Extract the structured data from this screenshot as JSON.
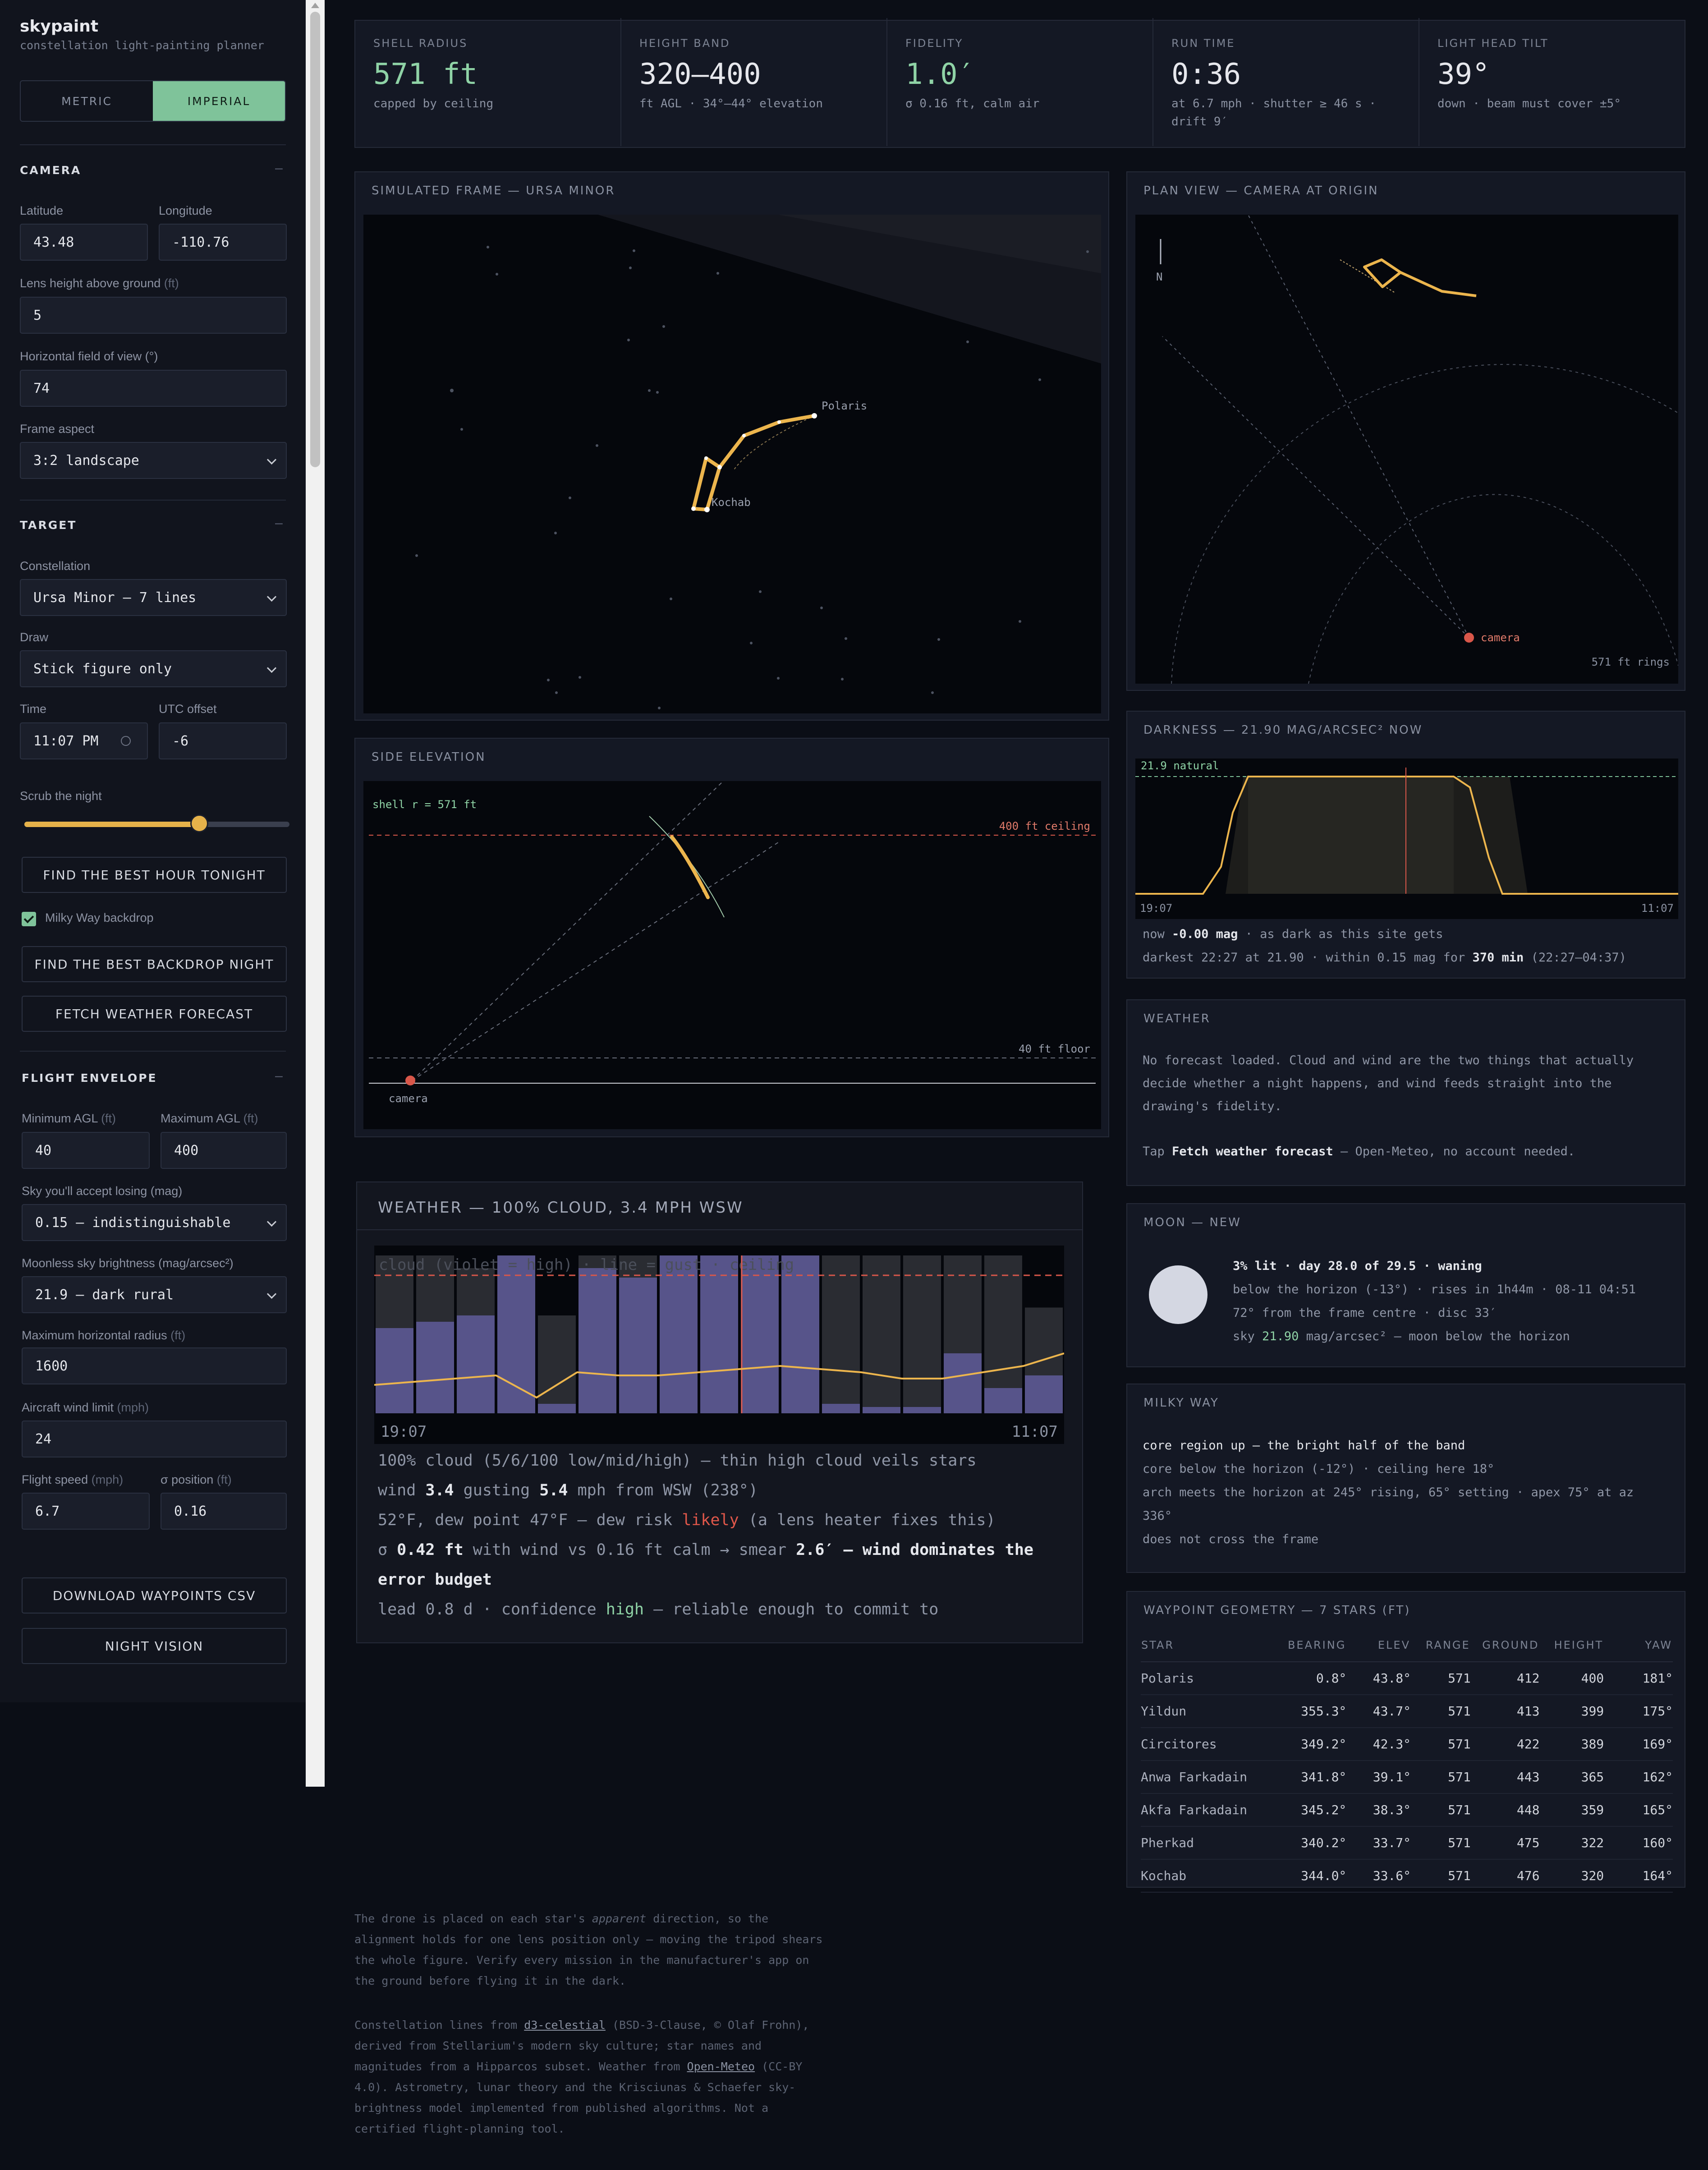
{
  "app": {
    "title": "skypaint",
    "subtitle": "constellation light-painting planner"
  },
  "units": {
    "metric": "METRIC",
    "imperial": "IMPERIAL",
    "selected": "IMPERIAL"
  },
  "camera": {
    "heading": "CAMERA",
    "collapse": "–",
    "latitude_label": "Latitude",
    "latitude": "43.48",
    "longitude_label": "Longitude",
    "longitude": "-110.76",
    "lens_label": "Lens height above ground",
    "lens_unit": "(ft)",
    "lens": "5",
    "fov_label": "Horizontal field of view (°)",
    "fov": "74",
    "aspect_label": "Frame aspect",
    "aspect": "3:2 landscape"
  },
  "target": {
    "heading": "TARGET",
    "collapse": "–",
    "constellation_label": "Constellation",
    "constellation": "Ursa Minor — 7 lines",
    "draw_label": "Draw",
    "draw": "Stick figure only",
    "time_label": "Time",
    "time": "11:07 PM",
    "utc_label": "UTC offset",
    "utc": "-6",
    "scrub_label": "Scrub the night",
    "scrub_fraction": 0.66,
    "best_hour_button": "FIND THE BEST HOUR TONIGHT",
    "milky_way_label": "Milky Way backdrop",
    "milky_way_checked": true,
    "best_backdrop_button": "FIND THE BEST BACKDROP NIGHT",
    "fetch_weather_button": "FETCH WEATHER FORECAST"
  },
  "flight": {
    "heading": "FLIGHT ENVELOPE",
    "collapse": "–",
    "min_agl_label": "Minimum AGL",
    "min_agl_unit": "(ft)",
    "min_agl": "40",
    "max_agl_label": "Maximum AGL",
    "max_agl_unit": "(ft)",
    "max_agl": "400",
    "sky_lose_label": "Sky you'll accept losing (mag)",
    "sky_lose": "0.15 — indistinguishable",
    "moonless_label": "Moonless sky brightness (mag/arcsec²)",
    "moonless": "21.9 — dark rural",
    "max_radius_label": "Maximum horizontal radius",
    "max_radius_unit": "(ft)",
    "max_radius": "1600",
    "wind_limit_label": "Aircraft wind limit",
    "wind_limit_unit": "(mph)",
    "wind_limit": "24",
    "speed_label": "Flight speed",
    "speed_unit": "(mph)",
    "speed": "6.7",
    "sigma_label": "σ position",
    "sigma_unit": "(ft)",
    "sigma": "0.16",
    "download_button": "DOWNLOAD WAYPOINTS CSV",
    "night_vision_button": "NIGHT VISION"
  },
  "kpis": [
    {
      "label": "SHELL RADIUS",
      "value": "571 ft",
      "note": "capped by ceiling",
      "accent": true
    },
    {
      "label": "HEIGHT BAND",
      "value": "320–400",
      "note": "ft AGL · 34°–44° elevation",
      "accent": false
    },
    {
      "label": "FIDELITY",
      "value": "1.0′",
      "note": "σ 0.16 ft, calm air",
      "accent": true
    },
    {
      "label": "RUN TIME",
      "value": "0:36",
      "note": "at 6.7 mph · shutter ≥ 46 s · drift 9′",
      "accent": false
    },
    {
      "label": "LIGHT HEAD TILT",
      "value": "39°",
      "note": "down · beam must cover ±5°",
      "accent": false
    }
  ],
  "sim_frame": {
    "title": "SIMULATED FRAME — URSA MINOR",
    "star_polaris": "Polaris",
    "star_kochab": "Kochab"
  },
  "plan_view": {
    "title": "PLAN VIEW — CAMERA AT ORIGIN",
    "north": "N",
    "camera": "camera",
    "rings": "571 ft rings"
  },
  "side_elev": {
    "title": "SIDE ELEVATION",
    "shell": "shell r = 571 ft",
    "ceiling": "400 ft ceiling",
    "floor": "40 ft floor",
    "camera": "camera"
  },
  "darkness": {
    "title": "DARKNESS — 21.90 MAG/ARCSEC² NOW",
    "natural_label": "21.9 natural",
    "start_time": "19:07",
    "end_time": "11:07",
    "now_prefix": "now",
    "now_value": "-0.00 mag",
    "now_suffix": "· as dark as this site gets",
    "darkest_text": "darkest 22:27 at 21.90 · within 0.15 mag for",
    "darkest_value": "370 min",
    "darkest_range": "(22:27–04:37)"
  },
  "weather_panel": {
    "title": "WEATHER",
    "p1": "No forecast loaded. Cloud and wind are the two things that actually decide whether a night happens, and wind feeds straight into the drawing's fidelity.",
    "p2_prefix": "Tap",
    "p2_bold": "Fetch weather forecast",
    "p2_suffix": "— Open-Meteo, no account needed."
  },
  "moon": {
    "title": "MOON — NEW",
    "line1": "3% lit · day 28.0 of 29.5 · waning",
    "line2": "below the horizon (-13°) · rises in 1h44m · 08-11 04:51",
    "line3": "72° from the frame centre · disc 33′",
    "line4_prefix": "sky",
    "line4_value": "21.90",
    "line4_suffix": "mag/arcsec² — moon below the horizon"
  },
  "milky_way": {
    "title": "MILKY WAY",
    "line1": "core region up — the bright half of the band",
    "line2": "core below the horizon (-12°) · ceiling here 18°",
    "line3": "arch meets the horizon at 245° rising, 65° setting · apex 75° at az 336°",
    "line4": "does not cross the frame"
  },
  "waypoints": {
    "title": "WAYPOINT GEOMETRY — 7 STARS (FT)",
    "headers": [
      "STAR",
      "BEARING",
      "ELEV",
      "RANGE",
      "GROUND",
      "HEIGHT",
      "YAW"
    ],
    "rows": [
      [
        "Polaris",
        "0.8°",
        "43.8°",
        "571",
        "412",
        "400",
        "181°"
      ],
      [
        "Yildun",
        "355.3°",
        "43.7°",
        "571",
        "413",
        "399",
        "175°"
      ],
      [
        "Circitores",
        "349.2°",
        "42.3°",
        "571",
        "422",
        "389",
        "169°"
      ],
      [
        "Anwa Farkadain",
        "341.8°",
        "39.1°",
        "571",
        "443",
        "365",
        "162°"
      ],
      [
        "Akfa Farkadain",
        "345.2°",
        "38.3°",
        "571",
        "448",
        "359",
        "165°"
      ],
      [
        "Pherkad",
        "340.2°",
        "33.7°",
        "571",
        "475",
        "322",
        "160°"
      ],
      [
        "Kochab",
        "344.0°",
        "33.6°",
        "571",
        "476",
        "320",
        "164°"
      ]
    ]
  },
  "weather_forecast": {
    "title": "WEATHER — 100% CLOUD, 3.4 MPH WSW",
    "legend": "cloud (violet = high) · line = gust · ceiling",
    "start_time": "19:07",
    "end_time": "11:07",
    "l1": "100% cloud (5/6/100 low/mid/high) — thin high cloud veils stars",
    "l2_a": "wind",
    "l2_b": "3.4",
    "l2_c": "gusting",
    "l2_d": "5.4",
    "l2_e": "mph from WSW (238°)",
    "l3_a": "52°F, dew point 47°F — dew risk",
    "l3_b": "likely",
    "l3_c": "(a lens heater fixes this)",
    "l4_a": "σ",
    "l4_b": "0.42 ft",
    "l4_c": "with wind vs 0.16 ft calm → smear",
    "l4_d": "2.6′ — wind dominates the error budget",
    "l5_a": "lead 0.8 d · confidence",
    "l5_b": "high",
    "l5_c": "— reliable enough to commit to"
  },
  "footer": {
    "p1_a": "The drone is placed on each star's",
    "p1_em": "apparent",
    "p1_b": "direction, so the alignment holds for one lens position only — moving the tripod shears the whole figure. Verify every mission in the manufacturer's app on the ground before flying it in the dark.",
    "p2_a": "Constellation lines from",
    "p2_link1": "d3-celestial",
    "p2_b": "(BSD-3-Clause, © Olaf Frohn), derived from Stellarium's modern sky culture; star names and magnitudes from a Hipparcos subset. Weather from",
    "p2_link2": "Open-Meteo",
    "p2_c": "(CC-BY 4.0). Astrometry, lunar theory and the Krisciunas & Schaefer sky-brightness model implemented from published algorithms. Not a certified flight-planning tool."
  },
  "colors": {
    "accent": "#7fc39a",
    "line": "#e8b24a",
    "danger": "#d9574a",
    "cloud": "#57548a"
  }
}
